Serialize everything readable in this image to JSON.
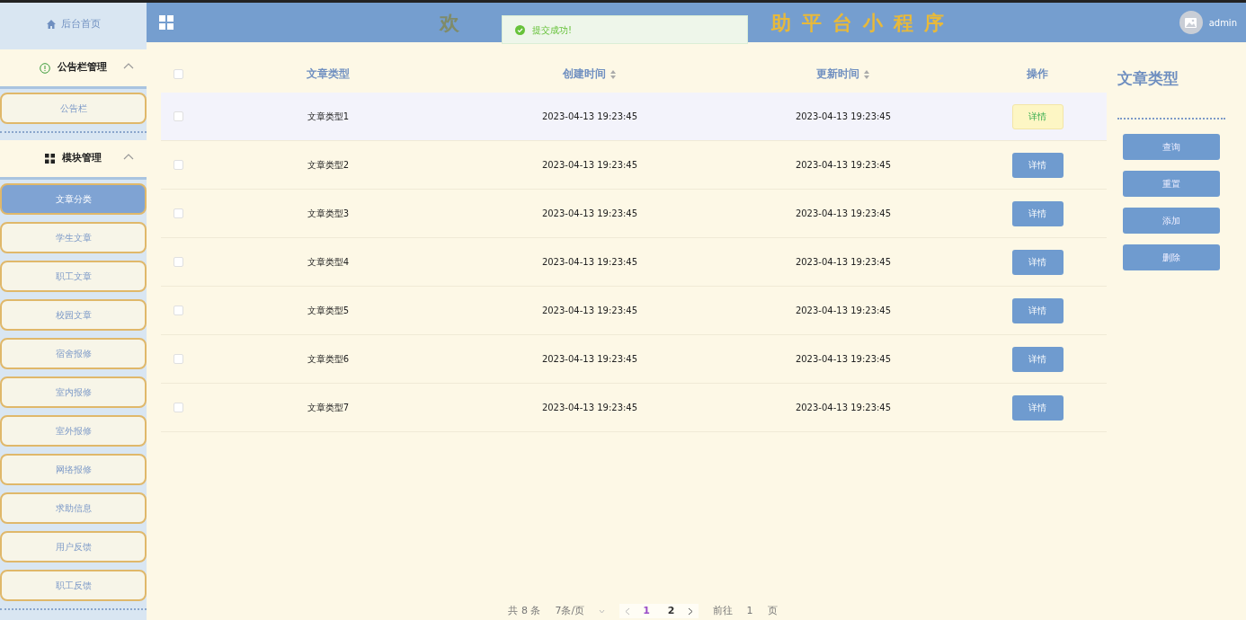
{
  "sidebar": {
    "home": {
      "label": "后台首页"
    },
    "groups": [
      {
        "label": "公告栏管理",
        "expanded": true,
        "items": [
          {
            "label": "公告栏",
            "selected": false
          }
        ]
      },
      {
        "label": "模块管理",
        "expanded": true,
        "items": [
          {
            "label": "文章分类",
            "selected": true
          },
          {
            "label": "学生文章",
            "selected": false
          },
          {
            "label": "职工文章",
            "selected": false
          },
          {
            "label": "校园文章",
            "selected": false
          },
          {
            "label": "宿舍报修",
            "selected": false
          },
          {
            "label": "室内报修",
            "selected": false
          },
          {
            "label": "室外报修",
            "selected": false
          },
          {
            "label": "网络报修",
            "selected": false
          },
          {
            "label": "求助信息",
            "selected": false
          },
          {
            "label": "用户反馈",
            "selected": false
          },
          {
            "label": "职工反馈",
            "selected": false
          }
        ]
      }
    ]
  },
  "header": {
    "title_left": "欢",
    "title_right": "助平台小程序",
    "user": "admin"
  },
  "toast": {
    "message": "提交成功!"
  },
  "table": {
    "all_checked": false,
    "columns": [
      {
        "label": "文章类型",
        "sortable": false
      },
      {
        "label": "创建时间",
        "sortable": true
      },
      {
        "label": "更新时间",
        "sortable": true
      },
      {
        "label": "操作",
        "sortable": false
      }
    ],
    "rows": [
      {
        "type": "文章类型1",
        "created": "2023-04-13 19:23:45",
        "updated": "2023-04-13 19:23:45",
        "action": "详情",
        "hovered": true,
        "checked": false
      },
      {
        "type": "文章类型2",
        "created": "2023-04-13 19:23:45",
        "updated": "2023-04-13 19:23:45",
        "action": "详情",
        "hovered": false,
        "checked": false
      },
      {
        "type": "文章类型3",
        "created": "2023-04-13 19:23:45",
        "updated": "2023-04-13 19:23:45",
        "action": "详情",
        "hovered": false,
        "checked": false
      },
      {
        "type": "文章类型4",
        "created": "2023-04-13 19:23:45",
        "updated": "2023-04-13 19:23:45",
        "action": "详情",
        "hovered": false,
        "checked": false
      },
      {
        "type": "文章类型5",
        "created": "2023-04-13 19:23:45",
        "updated": "2023-04-13 19:23:45",
        "action": "详情",
        "hovered": false,
        "checked": false
      },
      {
        "type": "文章类型6",
        "created": "2023-04-13 19:23:45",
        "updated": "2023-04-13 19:23:45",
        "action": "详情",
        "hovered": false,
        "checked": false
      },
      {
        "type": "文章类型7",
        "created": "2023-04-13 19:23:45",
        "updated": "2023-04-13 19:23:45",
        "action": "详情",
        "hovered": false,
        "checked": false
      }
    ]
  },
  "side_panel": {
    "title": "文章类型",
    "buttons": [
      "查询",
      "重置",
      "添加",
      "删除"
    ]
  },
  "pagination": {
    "total": "共 8 条",
    "page_size": "7条/页",
    "pages": [
      {
        "label": "1",
        "selected": true
      },
      {
        "label": "2",
        "selected": false
      }
    ],
    "goto_label": "前往",
    "goto_value": "1",
    "goto_suffix": "页"
  }
}
